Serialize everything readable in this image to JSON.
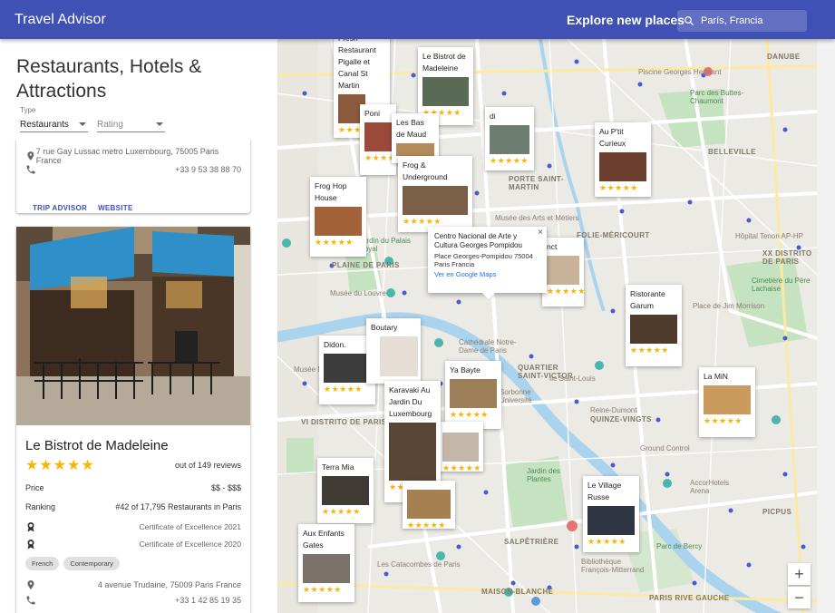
{
  "app": {
    "title": "Travel Advisor"
  },
  "header": {
    "explore": "Explore new places",
    "search_value": "París, Francia"
  },
  "sidebar": {
    "title": "Restaurants, Hotels & Attractions",
    "filter_type_label": "Type",
    "type_select": "Restaurants",
    "rating_select": "Rating"
  },
  "card1": {
    "address": "7 rue Gay Lussac metro Luxembourg, 75005 Paris France",
    "phone": "+33 9 53 38 88 70",
    "link_tripadvisor": "TRIP ADVISOR",
    "link_website": "WEBSITE"
  },
  "card2": {
    "name": "Le Bistrot de Madeleine",
    "stars": "★★★★★",
    "reviews": "out of 149 reviews",
    "price_label": "Price",
    "price_value": "$$ - $$$",
    "ranking_label": "Ranking",
    "ranking_value": "#42 of 17,795 Restaurants in Paris",
    "award1": "Certificate of Excellence 2021",
    "award2": "Certificate of Excellence 2020",
    "chips": [
      "French",
      "Contemporary"
    ],
    "address": "4 avenue Trudaine, 75009 Paris France",
    "phone": "+33 1 42 85 19 35"
  },
  "map": {
    "labels": [
      {
        "text": "DANUBE",
        "cls": "dist"
      },
      {
        "text": "Piscine Georges Hermant",
        "cls": ""
      },
      {
        "text": "Parc des Buttes-Chaumont",
        "cls": "green"
      },
      {
        "text": "PORTE SAINT-MARTIN",
        "cls": "dist"
      },
      {
        "text": "BELLEVILLE",
        "cls": "dist"
      },
      {
        "text": "Musée des Arts et Métiers",
        "cls": ""
      },
      {
        "text": "FOLIE-MÉRICOURT",
        "cls": "dist"
      },
      {
        "text": "Hôpital Tenon AP-HP",
        "cls": ""
      },
      {
        "text": "XX DISTRITO DE PARIS",
        "cls": "dist"
      },
      {
        "text": "Cimetière du Père Lachaise",
        "cls": "green"
      },
      {
        "text": "Jardin du Palais Royal",
        "cls": "green"
      },
      {
        "text": "Musée du Louvre",
        "cls": ""
      },
      {
        "text": "Place de Jim Morrison",
        "cls": ""
      },
      {
        "text": "Cathédrale Notre-Dame de Paris",
        "cls": ""
      },
      {
        "text": "Musée Marché",
        "cls": ""
      },
      {
        "text": "QUARTIER SAINT-VICTOR",
        "cls": "dist"
      },
      {
        "text": "VI DISTRITO DE PARIS",
        "cls": "dist"
      },
      {
        "text": "Sorbonne Université",
        "cls": ""
      },
      {
        "text": "Ile Saint-Louis",
        "cls": ""
      },
      {
        "text": "QUINZE-VINGTS",
        "cls": "dist"
      },
      {
        "text": "Jardin des Plantes",
        "cls": "green"
      },
      {
        "text": "Ground Control",
        "cls": ""
      },
      {
        "text": "AccorHotels Arena",
        "cls": ""
      },
      {
        "text": "PICPUS",
        "cls": "dist"
      },
      {
        "text": "Parc de Bercy",
        "cls": "green"
      },
      {
        "text": "SALPÊTRIÈRE",
        "cls": "dist"
      },
      {
        "text": "Les Catacombes de Paris",
        "cls": ""
      },
      {
        "text": "Bibliothèque François-Mitterrand",
        "cls": ""
      },
      {
        "text": "PARIS RIVE GAUCHE",
        "cls": "dist"
      },
      {
        "text": "MAISON-BLANCHE",
        "cls": "dist"
      },
      {
        "text": "Reine-Dumont",
        "cls": ""
      },
      {
        "text": "PLAINE DE PARIS",
        "cls": "dist"
      }
    ],
    "pins": [
      {
        "name": "Le Bistrot de Madeleine",
        "stars": "★★★★★"
      },
      {
        "name": "Poni",
        "stars": "★★★★★"
      },
      {
        "name": "Les Bas de Maud",
        "stars": "★★★★★"
      },
      {
        "name": "Frog & Underground",
        "stars": "★★★★★"
      },
      {
        "name": "Frog Hop House",
        "stars": "★★★★★"
      },
      {
        "name": "Au P'tit Curieux",
        "stars": "★★★★★"
      },
      {
        "name": "Ristorante Garum",
        "stars": "★★★★★"
      },
      {
        "name": "Boutary",
        "stars": "★★★★★"
      },
      {
        "name": "Didon.",
        "stars": "★★★★★"
      },
      {
        "name": "Ya Bayte",
        "stars": "★★★★★"
      },
      {
        "name": "Karavaki Au Jardin Du Luxembourg",
        "stars": "★★★★★"
      },
      {
        "name": "La MiN",
        "stars": "★★★★★"
      },
      {
        "name": "Terra Mia",
        "stars": "★★★★★"
      },
      {
        "name": "Le Village Russe",
        "stars": "★★★★★"
      },
      {
        "name": "Aux Enfants Gates",
        "stars": "★★★★★"
      },
      {
        "name": "Fresh Restaurant Pigalle et Canal St Martin",
        "stars": "★★★★★"
      }
    ],
    "info_window": {
      "title": "Centro Nacional de Arte y Cultura Georges Pompidou",
      "address": "Place Georges-Pompidou 75004 Paris Francia",
      "link": "Ver en Google Maps",
      "close": "×"
    },
    "zoom_in": "+",
    "zoom_out": "−"
  }
}
